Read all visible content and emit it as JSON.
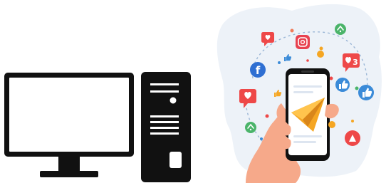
{
  "colors": {
    "device": "#111111",
    "screen": "#ffffff",
    "blob": "#edf2f8",
    "orbit": "#9bb6d6",
    "heart_red": "#ee4848",
    "facebook_blue": "#2f6fd2",
    "instagram_red": "#e8414f",
    "mail_orange": "#f5a623",
    "like_blue": "#3b8bd8",
    "green": "#4bb46a",
    "skin": "#f6a98a",
    "sleeve": "#f2a285"
  },
  "icons": [
    "computer-monitor-icon",
    "pc-tower-icon",
    "smartphone-icon",
    "paper-plane-icon",
    "facebook-icon",
    "instagram-icon",
    "heart-icon",
    "thumbs-up-icon",
    "play-icon",
    "share-icon"
  ],
  "notifications": {
    "heart_count": "3"
  }
}
